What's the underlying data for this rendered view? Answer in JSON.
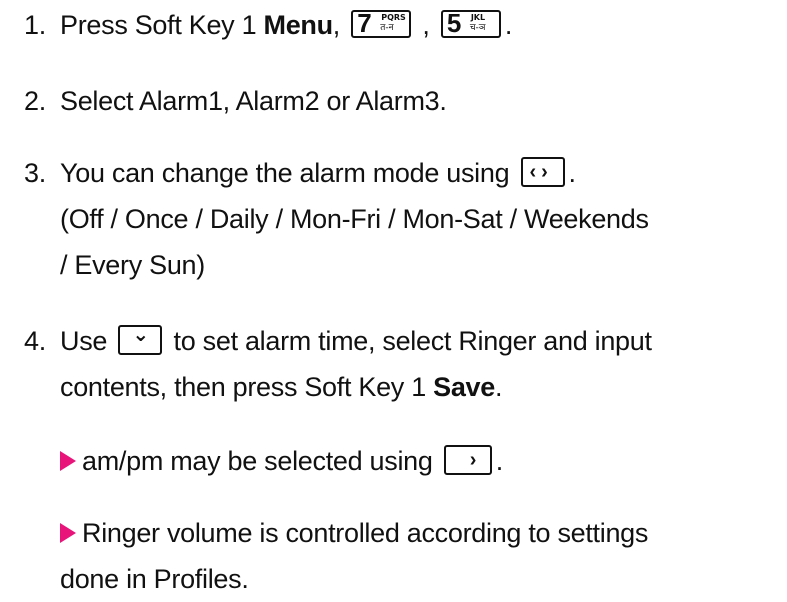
{
  "steps": [
    {
      "num": "1.",
      "text_a": "Press Soft Key 1 ",
      "bold": "Menu",
      "text_b": ",",
      "text_c": " ,",
      "text_d": "."
    },
    {
      "num": "2.",
      "text": "Select Alarm1, Alarm2 or Alarm3."
    },
    {
      "num": "3.",
      "line1": "You can change the alarm mode using",
      "line1_end": ".",
      "line2": "(Off / Once / Daily / Mon-Fri / Mon-Sat / Weekends",
      "line3": "/ Every Sun)"
    },
    {
      "num": "4.",
      "line1_a": "Use",
      "line1_b": "to set alarm time, select Ringer and input",
      "line2_a": "contents, then press Soft Key 1 ",
      "line2_bold": "Save",
      "line2_end": "."
    }
  ],
  "notes": [
    {
      "text_a": "am/pm may be selected using",
      "text_b": "."
    },
    {
      "line1": "Ringer volume is controlled according to settings",
      "line2": "done in Profiles."
    }
  ],
  "keys": {
    "seven": {
      "digit": "7",
      "latin": "PQRS",
      "devanagari": "त-न"
    },
    "five": {
      "digit": "5",
      "latin": "JKL",
      "devanagari": "च-ञ"
    },
    "nav_lr": {
      "icon": "left-right-nav-key-icon",
      "glyph": "‹ ›"
    },
    "nav_down": {
      "icon": "down-nav-key-icon",
      "glyph": "⌄"
    },
    "nav_right": {
      "icon": "right-nav-key-icon",
      "glyph": "›"
    }
  },
  "colors": {
    "bullet_arrow": "#e8147a",
    "text": "#111111"
  }
}
